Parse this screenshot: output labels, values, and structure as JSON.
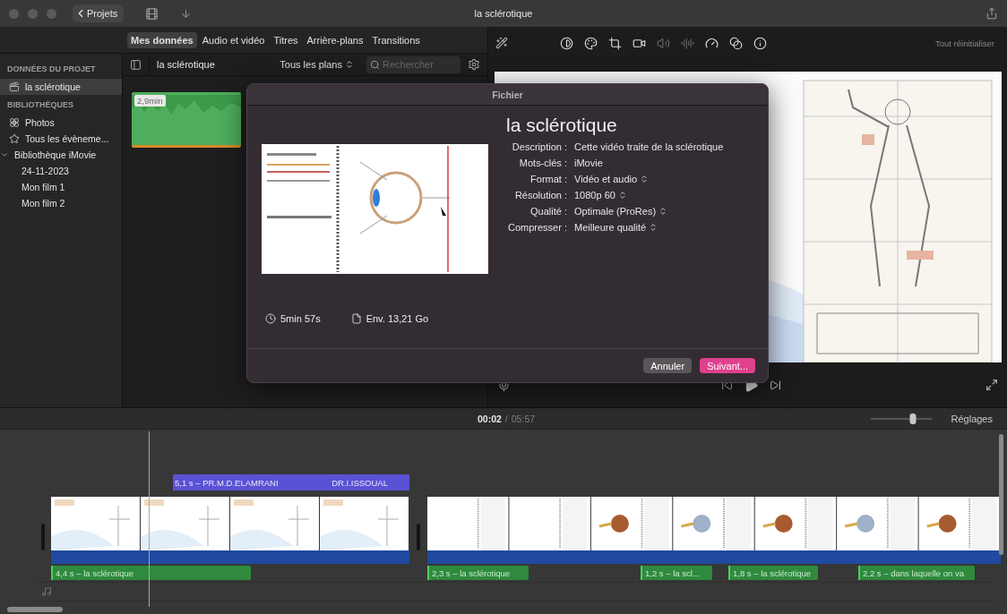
{
  "window": {
    "title": "la sclérotique",
    "back_button": "Projets"
  },
  "media_tabs": [
    {
      "label": "Mes données",
      "selected": true
    },
    {
      "label": "Audio et vidéo",
      "selected": false
    },
    {
      "label": "Titres",
      "selected": false
    },
    {
      "label": "Arrière-plans",
      "selected": false
    },
    {
      "label": "Transitions",
      "selected": false
    }
  ],
  "sidebar": {
    "sections": [
      {
        "heading": "DONNÉES DU PROJET",
        "items": [
          {
            "label": "la sclérotique",
            "kind": "project",
            "selected": true
          }
        ]
      },
      {
        "heading": "BIBLIOTHÈQUES",
        "items": [
          {
            "label": "Photos",
            "kind": "photos",
            "selected": false
          },
          {
            "label": "Tous les évèneme...",
            "kind": "events",
            "selected": false
          },
          {
            "label": "Bibliothèque iMovie",
            "kind": "library",
            "selected": false,
            "expanded": true,
            "children": [
              {
                "label": "24-11-2023",
                "selected": false
              },
              {
                "label": "Mon film 1",
                "selected": false
              },
              {
                "label": "Mon film 2",
                "selected": false
              }
            ]
          }
        ]
      }
    ]
  },
  "browser": {
    "title": "la sclérotique",
    "filter": "Tous les plans",
    "search_placeholder": "Rechercher",
    "clips": [
      {
        "duration": "2,9min"
      }
    ]
  },
  "viewer": {
    "reset_button": "Tout réinitialiser"
  },
  "dialog": {
    "title": "Fichier",
    "heading": "la sclérotique",
    "fields": [
      {
        "label": "Description :",
        "value": "Cette vidéo traite de la sclérotique",
        "kind": "text"
      },
      {
        "label": "Mots-clés :",
        "value": "iMovie",
        "kind": "text"
      },
      {
        "label": "Format :",
        "value": "Vidéo et audio",
        "kind": "popup"
      },
      {
        "label": "Résolution :",
        "value": "1080p 60",
        "kind": "popup"
      },
      {
        "label": "Qualité :",
        "value": "Optimale (ProRes)",
        "kind": "popup"
      },
      {
        "label": "Compresser :",
        "value": "Meilleure qualité",
        "kind": "popup"
      }
    ],
    "duration": "5min 57s",
    "size": "Env. 13,21 Go",
    "buttons": [
      {
        "label": "Annuler",
        "kind": "secondary"
      },
      {
        "label": "Suivant...",
        "kind": "primary"
      }
    ]
  },
  "timeline": {
    "current_time": "00:02",
    "separator": "/",
    "total_time": "05:57",
    "zoom": {
      "level": 0.7
    },
    "settings_button": "Réglages",
    "title_clip": {
      "label": "5,1 s – PR.M.D.ELAMRANI",
      "label_2": "DR.I.ISSOUAL"
    },
    "audio_clips": [
      {
        "label": "4,4 s – la sclérotique"
      },
      {
        "label": "2,3 s – la sclérotique"
      },
      {
        "label": "1,2 s – la scl..."
      },
      {
        "label": "1,8 s – la sclérotique"
      },
      {
        "label": "2,2 s – dans laquelle on va"
      }
    ]
  }
}
